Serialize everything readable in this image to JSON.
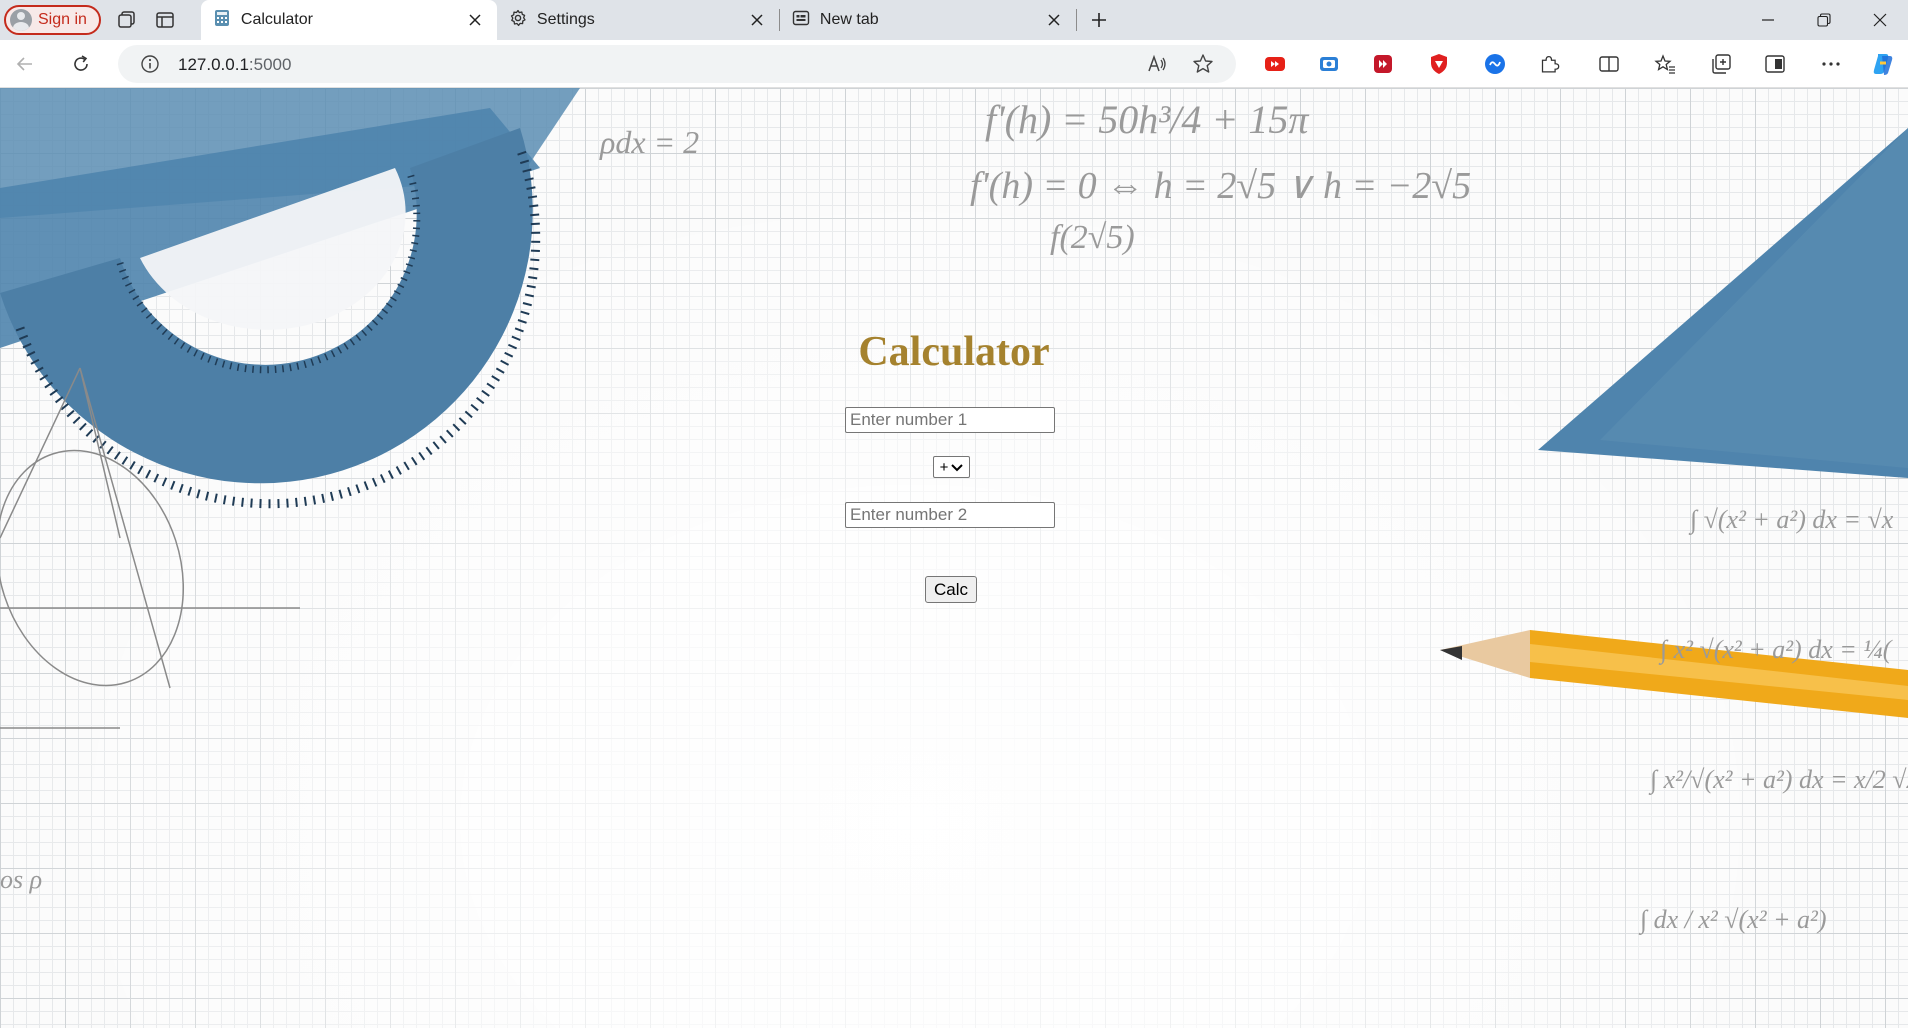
{
  "browser": {
    "signin_label": "Sign in",
    "tabs": [
      {
        "title": "Calculator",
        "active": true,
        "icon": "calculator-favicon-icon"
      },
      {
        "title": "Settings",
        "active": false,
        "icon": "gear-icon"
      },
      {
        "title": "New tab",
        "active": false,
        "icon": "newtab-page-icon"
      }
    ],
    "address": {
      "host": "127.0.0.1",
      "port": ":5000"
    },
    "colors": {
      "signin": "#c42b1c",
      "tabstrip": "#dfe3e8"
    }
  },
  "page": {
    "heading": "Calculator",
    "number1_placeholder": "Enter number 1",
    "operator_value": "+",
    "number2_placeholder": "Enter number 2",
    "calc_button": "Calc",
    "colors": {
      "heading": "#a5822e",
      "protractor": "#5b8db3",
      "pencil": "#f0a91a"
    }
  }
}
